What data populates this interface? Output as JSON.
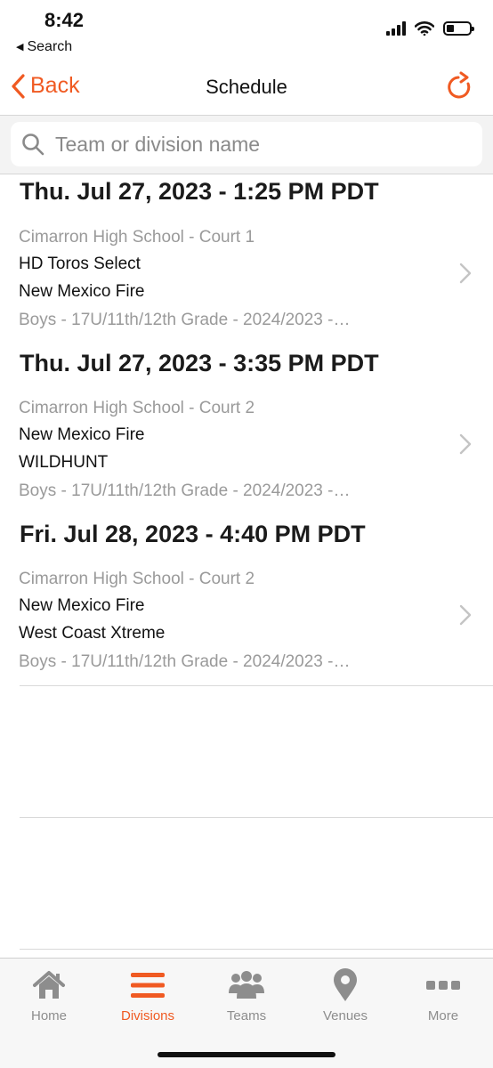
{
  "status_bar": {
    "time": "8:42",
    "back_app": "Search",
    "back_app_icon": "left-triangle-icon",
    "icons": [
      "cellular-signal-icon",
      "wifi-icon",
      "battery-icon"
    ]
  },
  "nav": {
    "back_label": "Back",
    "title": "Schedule",
    "refresh_icon": "refresh-icon",
    "accent_color": "#f05a22"
  },
  "search": {
    "placeholder": "Team or division name",
    "value": ""
  },
  "games": [
    {
      "date": "Thu. Jul 27, 2023 - 1:25 PM PDT",
      "venue": "Cimarron High School - Court 1",
      "team1": "HD Toros Select",
      "team2": "New Mexico Fire",
      "division": "Boys - 17U/11th/12th Grade - 2024/2023 -…"
    },
    {
      "date": "Thu. Jul 27, 2023 - 3:35 PM PDT",
      "venue": "Cimarron High School - Court 2",
      "team1": "New Mexico Fire",
      "team2": "WILDHUNT",
      "division": "Boys - 17U/11th/12th Grade - 2024/2023 -…"
    },
    {
      "date": "Fri. Jul 28, 2023 - 4:40 PM PDT",
      "venue": "Cimarron High School - Court 2",
      "team1": "New Mexico Fire",
      "team2": "West Coast Xtreme",
      "division": "Boys - 17U/11th/12th Grade - 2024/2023 -…"
    }
  ],
  "tabs": [
    {
      "label": "Home",
      "icon": "home-icon",
      "active": false
    },
    {
      "label": "Divisions",
      "icon": "menu-bars-icon",
      "active": true
    },
    {
      "label": "Teams",
      "icon": "people-icon",
      "active": false
    },
    {
      "label": "Venues",
      "icon": "map-pin-icon",
      "active": false
    },
    {
      "label": "More",
      "icon": "more-dots-icon",
      "active": false
    }
  ]
}
